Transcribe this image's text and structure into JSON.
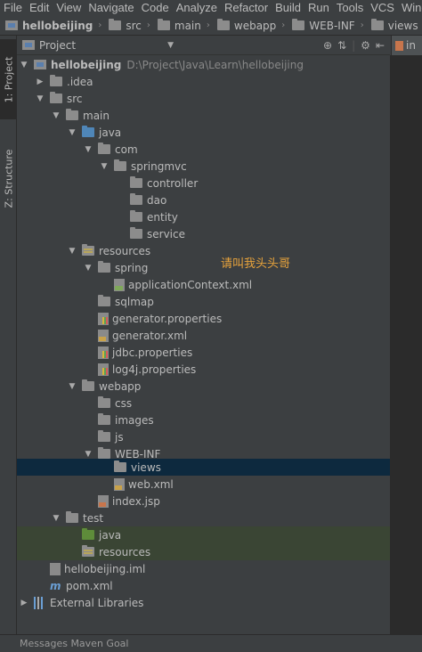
{
  "menu": [
    "File",
    "Edit",
    "View",
    "Navigate",
    "Code",
    "Analyze",
    "Refactor",
    "Build",
    "Run",
    "Tools",
    "VCS",
    "Window"
  ],
  "breadcrumb": [
    "hellobeijing",
    "src",
    "main",
    "webapp",
    "WEB-INF",
    "views"
  ],
  "left_tabs": {
    "project": "1: Project",
    "structure": "Z: Structure"
  },
  "tool_window": {
    "title": "Project"
  },
  "editor_tab": {
    "label": "in"
  },
  "tree": {
    "root": {
      "label": "hellobeijing",
      "path": "D:\\Project\\Java\\Learn\\hellobeijing"
    },
    "idea": ".idea",
    "src": "src",
    "main": "main",
    "java": "java",
    "com": "com",
    "springmvc": "springmvc",
    "controller": "controller",
    "dao": "dao",
    "entity": "entity",
    "service": "service",
    "resources": "resources",
    "spring": "spring",
    "applicationContext": "applicationContext.xml",
    "sqlmap": "sqlmap",
    "generator_props": "generator.properties",
    "generator_xml": "generator.xml",
    "jdbc_props": "jdbc.properties",
    "log4j_props": "log4j.properties",
    "webapp": "webapp",
    "css": "css",
    "images": "images",
    "js": "js",
    "webinf": "WEB-INF",
    "views": "views",
    "webxml": "web.xml",
    "indexjsp": "index.jsp",
    "test": "test",
    "test_java": "java",
    "test_resources": "resources",
    "iml": "hellobeijing.iml",
    "pom": "pom.xml",
    "external_libs": "External Libraries"
  },
  "annotation": "请叫我头头哥",
  "status_bar": "Messages Maven Goal",
  "colors": {
    "selection": "#0d293e",
    "annotation": "#e8a33c",
    "background": "#3c3f41"
  }
}
